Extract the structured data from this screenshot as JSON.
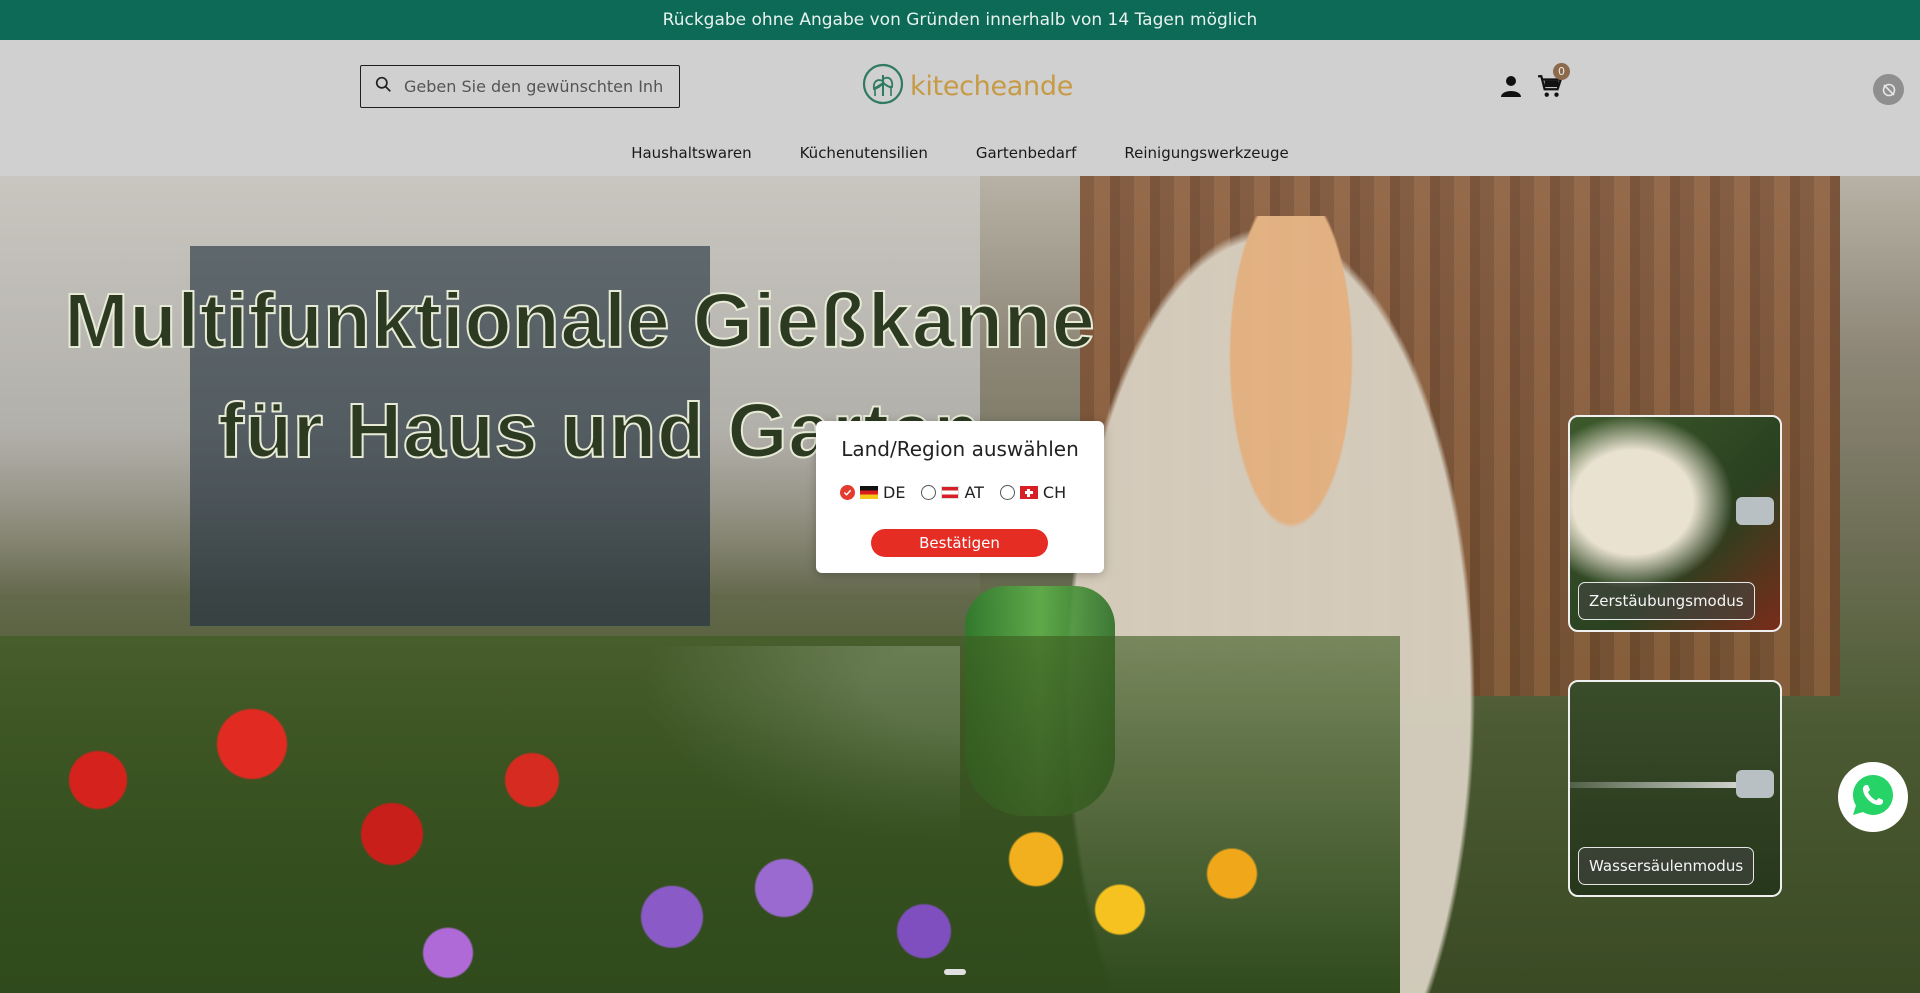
{
  "announcement": "Rückgabe ohne Angabe von Gründen innerhalb von 14 Tagen möglich",
  "search": {
    "placeholder": "Geben Sie den gewünschten Inh",
    "icon": "search-icon"
  },
  "logo": {
    "brand": "kitecheande",
    "icon": "leaf-house-icon"
  },
  "header": {
    "account_icon": "user-icon",
    "cart_icon": "cart-icon",
    "cart_count": "0",
    "corner_icon": "settings-icon"
  },
  "nav": [
    {
      "label": "Haushaltswaren"
    },
    {
      "label": "Küchenutensilien"
    },
    {
      "label": "Gartenbedarf"
    },
    {
      "label": "Reinigungswerkzeuge"
    }
  ],
  "hero": {
    "headline_line1": "Multifunktionale Gießkanne",
    "headline_line2": "für Haus und Garten",
    "modes": [
      {
        "label": "Zerstäubungsmodus"
      },
      {
        "label": "Wassersäulenmodus"
      }
    ]
  },
  "modal": {
    "title": "Land/Region auswählen",
    "options": [
      {
        "code": "DE",
        "selected": true
      },
      {
        "code": "AT",
        "selected": false
      },
      {
        "code": "CH",
        "selected": false
      }
    ],
    "confirm_label": "Bestätigen"
  },
  "whatsapp_icon": "whatsapp-icon",
  "colors": {
    "announcement_bg": "#0d6a57",
    "brand": "#c79a45",
    "accent": "#e52d24"
  }
}
